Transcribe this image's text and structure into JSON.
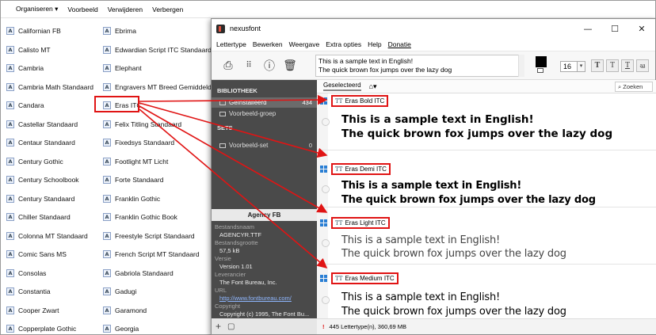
{
  "explorer_toolbar": {
    "organize": "Organiseren ▾",
    "preview": "Voorbeeld",
    "delete": "Verwijderen",
    "hide": "Verbergen"
  },
  "font_list_col1": [
    "Californian FB",
    "Calisto MT",
    "Cambria",
    "Cambria Math Standaard",
    "Candara",
    "Castellar Standaard",
    "Centaur Standaard",
    "Century Gothic",
    "Century Schoolbook",
    "Century Standaard",
    "Chiller Standaard",
    "Colonna MT Standaard",
    "Comic Sans MS",
    "Consolas",
    "Constantia",
    "Cooper Zwart",
    "Copperplate Gothic"
  ],
  "font_list_col2": [
    "Ebrima",
    "Edwardian Script ITC Standaard",
    "Elephant",
    "Engravers MT Breed Gemiddeld",
    "Eras ITC",
    "Felix Titling Standaard",
    "Fixedsys Standaard",
    "Footlight MT Licht",
    "Forte Standaard",
    "Franklin Gothic",
    "Franklin Gothic Book",
    "Freestyle Script Standaard",
    "French Script MT Standaard",
    "Gabriola Standaard",
    "Gadugi",
    "Garamond",
    "Georgia"
  ],
  "font_icon": "A",
  "nexus": {
    "title": "nexusfont",
    "window_buttons": {
      "minimize": "—",
      "maximize": "☐",
      "close": "✕"
    },
    "menu": [
      "Lettertype",
      "Bewerken",
      "Weergave",
      "Extra opties",
      "Help",
      "Donatie"
    ],
    "sample_text_line1": "This is a sample text in English!",
    "sample_text_line2": "The quick brown fox jumps over the lazy dog",
    "size_value": "16",
    "style_buttons": [
      "T",
      "T",
      "T",
      "a͟a"
    ],
    "library_heading": "BIBLIOTHEEK",
    "installed_label": "Geïnstalleerd",
    "installed_count": "434",
    "example_group": "Voorbeeld-groep",
    "sets_heading": "SETS",
    "example_set": "Voorbeeld-set",
    "example_set_count": "0",
    "selected_font": "Agency FB",
    "meta": {
      "filename_label": "Bestandsnaam",
      "filename": "AGENCYR.TTF",
      "filesize_label": "Bestandsgrootte",
      "filesize": "57,5 kB",
      "version_label": "Versie",
      "version": "Version 1.01",
      "vendor_label": "Leverancier",
      "vendor": "The Font Bureau, Inc.",
      "url_label": "URL",
      "url": "http://www.fontbureau.com/",
      "copyright_label": "Copyright",
      "copyright": "Copyright (c) 1995, The Font Bu..."
    },
    "tab_selected": "Geselecteerd",
    "search_placeholder": "Zoeken",
    "cards": [
      {
        "name": "Eras Bold ITC"
      },
      {
        "name": "Eras Demi ITC"
      },
      {
        "name": "Eras Light ITC"
      },
      {
        "name": "Eras Medium ITC"
      }
    ],
    "status_text": "445 Lettertype(n), 360,69 MB",
    "status_icon": "!"
  },
  "colors": {
    "highlight": "#e01414",
    "sidebar": "#4a4a4a"
  }
}
